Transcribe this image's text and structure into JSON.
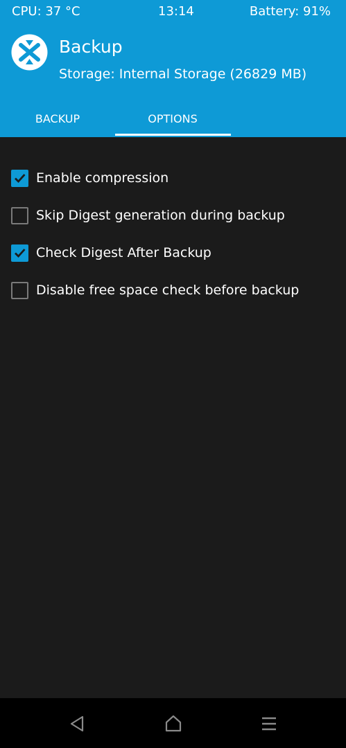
{
  "status_bar": {
    "cpu": "CPU: 37 °C",
    "time": "13:14",
    "battery": "Battery: 91%"
  },
  "header": {
    "title": "Backup",
    "storage": "Storage: Internal Storage (26829 MB)",
    "logo_icon": "twrp-logo-icon"
  },
  "tabs": [
    {
      "label": "BACKUP",
      "active": false
    },
    {
      "label": "OPTIONS",
      "active": true
    }
  ],
  "options": [
    {
      "label": "Enable compression",
      "checked": true
    },
    {
      "label": "Skip Digest generation during backup",
      "checked": false
    },
    {
      "label": "Check Digest After Backup",
      "checked": true
    },
    {
      "label": "Disable free space check before backup",
      "checked": false
    }
  ],
  "nav_bar": {
    "icons": [
      "back-icon",
      "home-icon",
      "menu-icon"
    ]
  },
  "colors": {
    "accent": "#0e9ad6",
    "background": "#1b1b1b",
    "nav_background": "#000000"
  }
}
